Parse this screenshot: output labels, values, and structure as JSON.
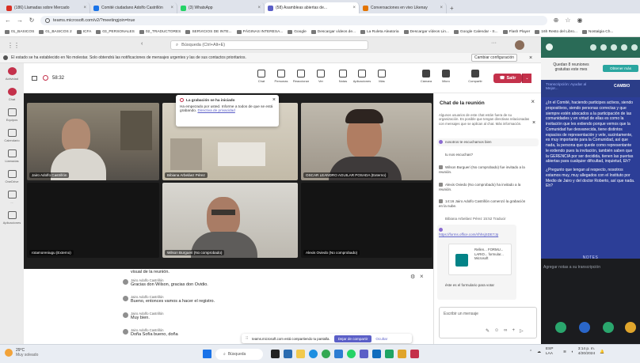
{
  "browser": {
    "tabs": [
      {
        "label": "(186) Llamadas sobre Mercado",
        "color": "#d93025"
      },
      {
        "label": "Comité ciudadano Adolfo Castrillón",
        "color": "#1a73e8"
      },
      {
        "label": "(3) WhatsApp",
        "color": "#25d366"
      },
      {
        "label": "(58) Asambleas abiertas de...",
        "color": "#5b5fc7"
      },
      {
        "label": "Conversaciones en vivo Likenay",
        "color": "#e37400"
      }
    ],
    "url": "teams.microsoft.com/v2/?meetingjoin=true",
    "bookmarks": [
      "01_BASICOS",
      "01_BASICOS 2",
      "ICFA",
      "03_PERSONALES",
      "02_TRADUCTORES",
      "SERVICIOS DE INTE...",
      "PÁGINAS INTERESA...",
      "Google",
      "Descargar vídeos de...",
      "La Ruleta Aleatoria",
      "Descargar vídeos Lin...",
      "Google Calendar - S...",
      "Flash Player",
      "16h Resto del Libro...",
      "Nostalgia Ch..."
    ]
  },
  "teams": {
    "search_placeholder": "Búsqueda (Ctrl+Alt+E)",
    "info_text": "El estado se ha establecido en No molestar. Solo obtendrá las notificaciones de mensajes urgentes y las de sus contactos prioritarios.",
    "info_button": "Cambiar configuración",
    "rail": [
      "Actividad",
      "Chat",
      "Equipos",
      "Calendario",
      "Llamadas",
      "OneDrive",
      "...",
      "Aplicaciones"
    ],
    "timer": "58:32",
    "tools": [
      "Chat",
      "Personas",
      "Reaccionar",
      "Ver",
      "Notas",
      "Aplicaciones",
      "Más",
      "Cámara",
      "Micro",
      "Compartir"
    ],
    "leave_label": "Salir"
  },
  "tiles": [
    {
      "name": "Jairo Adolfo Castrillón"
    },
    {
      "name": "Bibiana Arbeláez Pérez"
    },
    {
      "name": "OSCAR LEANDRO AGUILAR POSADA (Externo)"
    },
    {
      "name": "rotamoreniugu (Externo)"
    },
    {
      "name": "Wilson Burgueri (No comprobado)"
    },
    {
      "name": "Alexis Oviedo (No comprobado)"
    }
  ],
  "recording_toast": {
    "title": "La grabación se ha iniciado",
    "body": "Ha empezado por usted. Informe a todos de que se está grabando.",
    "link": "Directiva de privacidad"
  },
  "captions": [
    {
      "who": "",
      "text": "visual de la reunión."
    },
    {
      "who": "Jairo Adolfo Castrillón",
      "text": "Gracias don Wilson, gracias don Ovidio."
    },
    {
      "who": "Jairo Adolfo Castrillón",
      "text": "Bueno, entonces vamos a hacer el registro."
    },
    {
      "who": "Jairo Adolfo Castrillón",
      "text": "Muy bien."
    },
    {
      "who": "Jairo Adolfo Castrillón",
      "text": "Doña Sofía bueno, doña"
    }
  ],
  "share_toast": {
    "text": "teams.microsoft.com está compartiendo tu pantalla.",
    "button": "Dejar de compartir",
    "hide": "Ocultar"
  },
  "chat": {
    "title": "Chat de la reunión",
    "notice": "Algunos usuarios de este chat están fuera de su organización. Es posible que tengan directivas relacionadas con mensajes que se aplican al chat. Más información.",
    "messages": [
      "nosotros te escuchamos bien",
      "tu nos escuchas?",
      "Wilson Burgueri (No comprobado) fue invitado a la reunión.",
      "Alexis Oviedo (No comprobado) ha invitado a la reunión.",
      "14:16  Jairo Adolfo Castrillón comenzó la grabación en la nube.",
      "Bibiana Arbeláez Pérez  15:52  Traducir",
      "https://forms.office.com/r/hhsjSDE7Jp",
      "Rellen... FORMU... LARIO... formular... Microsoft",
      "éste es el formulario para votar"
    ],
    "input_placeholder": "Escribir un mensaje"
  },
  "side_panel": {
    "offer_text": "Quedan 8 reuniones gratuitas este mes",
    "offer_button": "Obtener más",
    "transcript_label": "Transcripción: Ayudar al Mejor...",
    "transcript_action": "CAMBIO",
    "paragraphs": [
      "¿In el Comité, haciendo participes activos, siendo propositivos, siendo personas correctas y que siempre estén abocados a la participación de las comunidades y en virtud de ellas es como la invitación que les extiendo porque vemos que la Comunidad fue desvanecida, tiene distintos espacios de representación y vele, sucintamente, es muy importante para la Comunidad, así que nada, la persona que quede como representante le extiendo pues la invitación, también saben que la GERENCIA por ser decidida, tienen las puertas abiertas para cualquier dificultad, inquietud, Eh?",
      "¿Pregunto que tengan al respecto, nosotros estamos muy, muy allegados con el Instituto por Medio de Jairo y del doctor Roberto, así que nada. Eh?"
    ],
    "notes_title": "NOTES",
    "notes_placeholder": "Agregar notas a su transcripción"
  },
  "taskbar": {
    "weather_temp": "29°C",
    "weather_text": "Muy soleado",
    "search": "Búsqueda",
    "lang": "ESP LAA",
    "time": "3:14 p. m.",
    "date": "4/20/2024"
  }
}
